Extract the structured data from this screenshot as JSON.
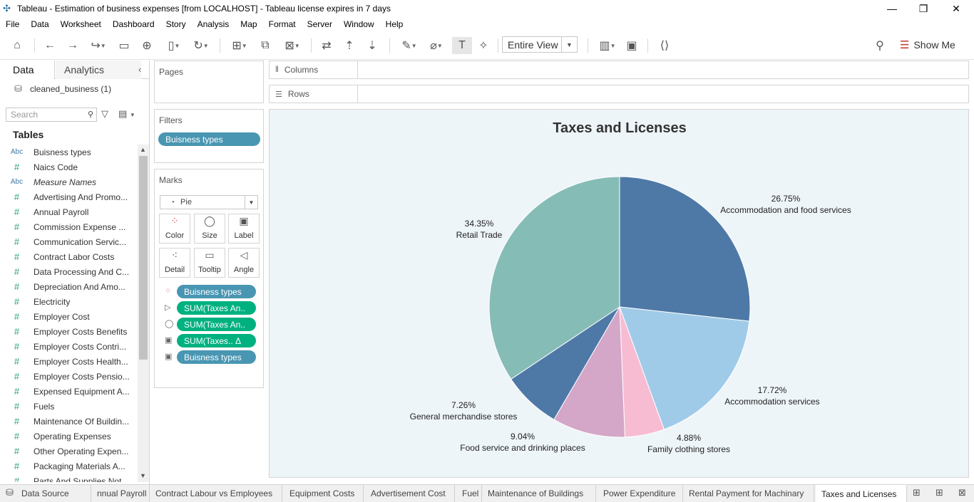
{
  "window": {
    "title": "Tableau - Estimation of business expenses [from LOCALHOST] - Tableau license expires in 7 days",
    "minimize": "—",
    "restore": "❐",
    "close": "✕"
  },
  "menu": [
    "File",
    "Data",
    "Worksheet",
    "Dashboard",
    "Story",
    "Analysis",
    "Map",
    "Format",
    "Server",
    "Window",
    "Help"
  ],
  "toolbar": {
    "view_mode": "Entire View",
    "show_me": "Show Me"
  },
  "left_pane": {
    "tab_data": "Data",
    "tab_analytics": "Analytics",
    "data_source": "cleaned_business (1)",
    "search_placeholder": "Search",
    "tables_header": "Tables",
    "fields": [
      {
        "type": "Abc",
        "name": "Buisness types",
        "italic": false
      },
      {
        "type": "#",
        "name": "Naics Code",
        "italic": false
      },
      {
        "type": "Abc",
        "name": "Measure Names",
        "italic": true
      },
      {
        "type": "#",
        "name": "Advertising And Promo...",
        "italic": false
      },
      {
        "type": "#",
        "name": "Annual Payroll",
        "italic": false
      },
      {
        "type": "#",
        "name": "Commission Expense ...",
        "italic": false
      },
      {
        "type": "#",
        "name": "Communication Servic...",
        "italic": false
      },
      {
        "type": "#",
        "name": "Contract Labor Costs",
        "italic": false
      },
      {
        "type": "#",
        "name": "Data Processing And C...",
        "italic": false
      },
      {
        "type": "#",
        "name": "Depreciation And Amo...",
        "italic": false
      },
      {
        "type": "#",
        "name": "Electricity",
        "italic": false
      },
      {
        "type": "#",
        "name": "Employer Cost",
        "italic": false
      },
      {
        "type": "#",
        "name": "Employer Costs Benefits",
        "italic": false
      },
      {
        "type": "#",
        "name": "Employer Costs Contri...",
        "italic": false
      },
      {
        "type": "#",
        "name": "Employer Costs Health...",
        "italic": false
      },
      {
        "type": "#",
        "name": "Employer Costs Pensio...",
        "italic": false
      },
      {
        "type": "#",
        "name": "Expensed Equipment A...",
        "italic": false
      },
      {
        "type": "#",
        "name": "Fuels",
        "italic": false
      },
      {
        "type": "#",
        "name": "Maintenance Of Buildin...",
        "italic": false
      },
      {
        "type": "#",
        "name": "Operating Expenses",
        "italic": false
      },
      {
        "type": "#",
        "name": "Other Operating Expen...",
        "italic": false
      },
      {
        "type": "#",
        "name": "Packaging Materials A...",
        "italic": false
      },
      {
        "type": "#",
        "name": "Parts And Supplies Not...",
        "italic": false
      }
    ]
  },
  "shelves": {
    "pages": "Pages",
    "filters": "Filters",
    "filter_pill": "Buisness types",
    "marks": "Marks",
    "mark_type": "Pie",
    "mark_buttons": [
      "Color",
      "Size",
      "Label",
      "Detail",
      "Tooltip",
      "Angle"
    ],
    "mark_pills": [
      {
        "label": "Buisness types",
        "color": "blue"
      },
      {
        "label": "SUM(Taxes An..",
        "color": "green"
      },
      {
        "label": "SUM(Taxes An..",
        "color": "green"
      },
      {
        "label": "SUM(Taxes..  Δ",
        "color": "green"
      },
      {
        "label": "Buisness types",
        "color": "blue"
      }
    ],
    "columns": "Columns",
    "rows": "Rows"
  },
  "chart_data": {
    "type": "pie",
    "title": "Taxes and Licenses",
    "slices": [
      {
        "label": "Accommodation and food services",
        "percent": 26.75,
        "color": "#4e79a7"
      },
      {
        "label": "Accommodation services",
        "percent": 17.72,
        "color": "#a0cbe8"
      },
      {
        "label": "Family clothing stores",
        "percent": 4.88,
        "color": "#f7bcd2"
      },
      {
        "label": "Food service and drinking places",
        "percent": 9.04,
        "color": "#d4a6c8"
      },
      {
        "label": "General merchandise stores",
        "percent": 7.26,
        "color": "#4e79a7"
      },
      {
        "label": "Retail Trade",
        "percent": 34.35,
        "color": "#86bcb6"
      }
    ],
    "percent_labels": [
      "26.75%",
      "17.72%",
      "4.88%",
      "9.04%",
      "7.26%",
      "34.35%"
    ]
  },
  "sheet_tabs": [
    {
      "label": "Data Source",
      "active": false
    },
    {
      "label": "nnual Payroll",
      "active": false
    },
    {
      "label": "Contract Labour vs Employees",
      "active": false
    },
    {
      "label": "Equipment Costs",
      "active": false
    },
    {
      "label": "Advertisement Cost",
      "active": false
    },
    {
      "label": "Fuel",
      "active": false
    },
    {
      "label": "Maintenance of Buildings",
      "active": false
    },
    {
      "label": "Power Expenditure",
      "active": false
    },
    {
      "label": "Rental Payment for Machinary",
      "active": false
    },
    {
      "label": "Taxes and Licenses",
      "active": true
    }
  ]
}
